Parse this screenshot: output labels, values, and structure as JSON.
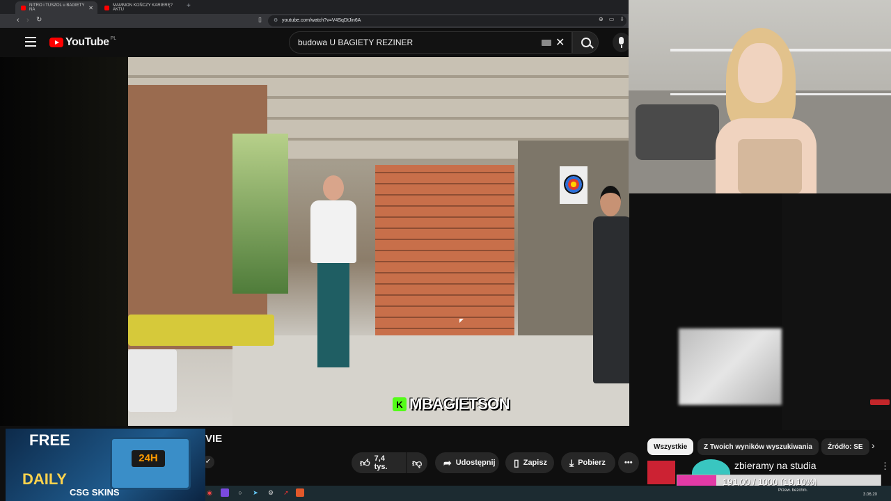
{
  "browser": {
    "tabs": [
      {
        "label": "NITRO i TUSZOL u BAGIETY NA",
        "active": true
      },
      {
        "label": "MAMMON KOŃCZY KARIERĘ? AKTU",
        "active": false
      }
    ],
    "url": "youtube.com/watch?v=V4SqDtJin6A"
  },
  "youtube": {
    "logo_text": "YouTube",
    "country_code": "PL",
    "search_query": "budowa U BAGIETY REZINER",
    "video_caption": "MBAGIETSON",
    "caption_badge": "K",
    "title_fragment": "VIE",
    "actions": {
      "like": "7,4 tys.",
      "share": "Udostępnij",
      "save": "Zapisz",
      "download": "Pobierz"
    },
    "chips": [
      "Wszystkie",
      "Z Twoich wyników wyszukiwania",
      "Źródło: SE"
    ]
  },
  "ad": {
    "line1": "FREE",
    "line2": "DAILY",
    "timer": "24H",
    "brand": "CSG SKINS"
  },
  "overlay": {
    "goal_title": "zbieramy na studia",
    "goal_text": "191.00 / 1000 (19.10%)",
    "goal_fraction": 0.191
  },
  "taskbar": {
    "status": "Przew. bezchm.",
    "date": "3.06.20"
  },
  "colors": {
    "youtube_red": "#ff0000",
    "kick_green": "#53fc18",
    "goal_pink": "#e23aa6"
  }
}
